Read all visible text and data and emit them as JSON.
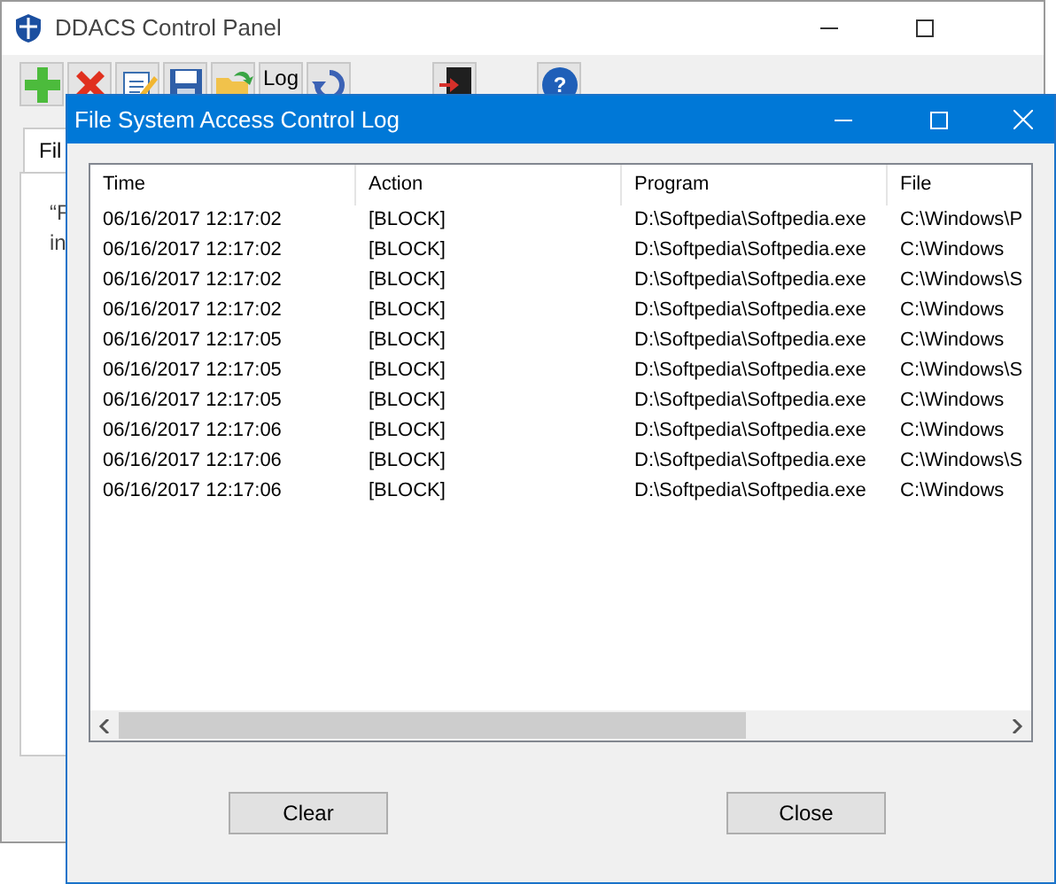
{
  "main_window": {
    "title": "DDACS Control Panel",
    "toolbar": [
      {
        "kind": "add"
      },
      {
        "kind": "delete"
      },
      {
        "kind": "edit"
      },
      {
        "kind": "save"
      },
      {
        "kind": "open"
      },
      {
        "kind": "text",
        "label": "Log"
      },
      {
        "kind": "refresh"
      },
      {
        "kind": "exit"
      },
      {
        "kind": "help",
        "label": "?"
      }
    ],
    "tabs": [
      {
        "label": "Fil",
        "selected": true
      }
    ],
    "text_fragments": [
      "“F",
      "in"
    ]
  },
  "dialog": {
    "title": "File System Access Control Log",
    "table": {
      "columns": [
        "Time",
        "Action",
        "Program",
        "File"
      ],
      "rows": [
        [
          "06/16/2017 12:17:02",
          "[BLOCK]",
          "D:\\Softpedia\\Softpedia.exe",
          "C:\\Windows\\P"
        ],
        [
          "06/16/2017 12:17:02",
          "[BLOCK]",
          "D:\\Softpedia\\Softpedia.exe",
          "C:\\Windows"
        ],
        [
          "06/16/2017 12:17:02",
          "[BLOCK]",
          "D:\\Softpedia\\Softpedia.exe",
          "C:\\Windows\\S"
        ],
        [
          "06/16/2017 12:17:02",
          "[BLOCK]",
          "D:\\Softpedia\\Softpedia.exe",
          "C:\\Windows"
        ],
        [
          "06/16/2017 12:17:05",
          "[BLOCK]",
          "D:\\Softpedia\\Softpedia.exe",
          "C:\\Windows"
        ],
        [
          "06/16/2017 12:17:05",
          "[BLOCK]",
          "D:\\Softpedia\\Softpedia.exe",
          "C:\\Windows\\S"
        ],
        [
          "06/16/2017 12:17:05",
          "[BLOCK]",
          "D:\\Softpedia\\Softpedia.exe",
          "C:\\Windows"
        ],
        [
          "06/16/2017 12:17:06",
          "[BLOCK]",
          "D:\\Softpedia\\Softpedia.exe",
          "C:\\Windows"
        ],
        [
          "06/16/2017 12:17:06",
          "[BLOCK]",
          "D:\\Softpedia\\Softpedia.exe",
          "C:\\Windows\\S"
        ],
        [
          "06/16/2017 12:17:06",
          "[BLOCK]",
          "D:\\Softpedia\\Softpedia.exe",
          "C:\\Windows"
        ]
      ]
    },
    "buttons": [
      "Clear",
      "Close"
    ]
  }
}
